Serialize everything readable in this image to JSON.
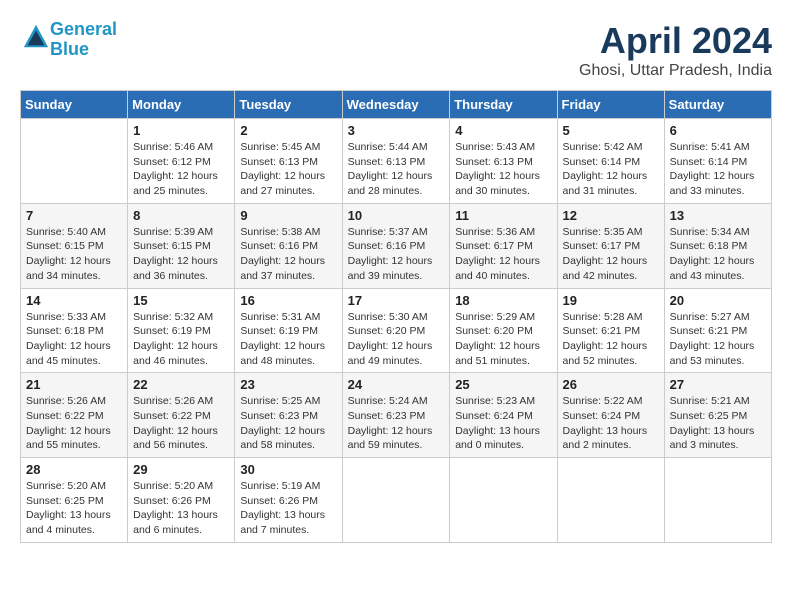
{
  "header": {
    "logo_line1": "General",
    "logo_line2": "Blue",
    "month": "April 2024",
    "location": "Ghosi, Uttar Pradesh, India"
  },
  "weekdays": [
    "Sunday",
    "Monday",
    "Tuesday",
    "Wednesday",
    "Thursday",
    "Friday",
    "Saturday"
  ],
  "weeks": [
    [
      {
        "day": "",
        "detail": ""
      },
      {
        "day": "1",
        "detail": "Sunrise: 5:46 AM\nSunset: 6:12 PM\nDaylight: 12 hours\nand 25 minutes."
      },
      {
        "day": "2",
        "detail": "Sunrise: 5:45 AM\nSunset: 6:13 PM\nDaylight: 12 hours\nand 27 minutes."
      },
      {
        "day": "3",
        "detail": "Sunrise: 5:44 AM\nSunset: 6:13 PM\nDaylight: 12 hours\nand 28 minutes."
      },
      {
        "day": "4",
        "detail": "Sunrise: 5:43 AM\nSunset: 6:13 PM\nDaylight: 12 hours\nand 30 minutes."
      },
      {
        "day": "5",
        "detail": "Sunrise: 5:42 AM\nSunset: 6:14 PM\nDaylight: 12 hours\nand 31 minutes."
      },
      {
        "day": "6",
        "detail": "Sunrise: 5:41 AM\nSunset: 6:14 PM\nDaylight: 12 hours\nand 33 minutes."
      }
    ],
    [
      {
        "day": "7",
        "detail": "Sunrise: 5:40 AM\nSunset: 6:15 PM\nDaylight: 12 hours\nand 34 minutes."
      },
      {
        "day": "8",
        "detail": "Sunrise: 5:39 AM\nSunset: 6:15 PM\nDaylight: 12 hours\nand 36 minutes."
      },
      {
        "day": "9",
        "detail": "Sunrise: 5:38 AM\nSunset: 6:16 PM\nDaylight: 12 hours\nand 37 minutes."
      },
      {
        "day": "10",
        "detail": "Sunrise: 5:37 AM\nSunset: 6:16 PM\nDaylight: 12 hours\nand 39 minutes."
      },
      {
        "day": "11",
        "detail": "Sunrise: 5:36 AM\nSunset: 6:17 PM\nDaylight: 12 hours\nand 40 minutes."
      },
      {
        "day": "12",
        "detail": "Sunrise: 5:35 AM\nSunset: 6:17 PM\nDaylight: 12 hours\nand 42 minutes."
      },
      {
        "day": "13",
        "detail": "Sunrise: 5:34 AM\nSunset: 6:18 PM\nDaylight: 12 hours\nand 43 minutes."
      }
    ],
    [
      {
        "day": "14",
        "detail": "Sunrise: 5:33 AM\nSunset: 6:18 PM\nDaylight: 12 hours\nand 45 minutes."
      },
      {
        "day": "15",
        "detail": "Sunrise: 5:32 AM\nSunset: 6:19 PM\nDaylight: 12 hours\nand 46 minutes."
      },
      {
        "day": "16",
        "detail": "Sunrise: 5:31 AM\nSunset: 6:19 PM\nDaylight: 12 hours\nand 48 minutes."
      },
      {
        "day": "17",
        "detail": "Sunrise: 5:30 AM\nSunset: 6:20 PM\nDaylight: 12 hours\nand 49 minutes."
      },
      {
        "day": "18",
        "detail": "Sunrise: 5:29 AM\nSunset: 6:20 PM\nDaylight: 12 hours\nand 51 minutes."
      },
      {
        "day": "19",
        "detail": "Sunrise: 5:28 AM\nSunset: 6:21 PM\nDaylight: 12 hours\nand 52 minutes."
      },
      {
        "day": "20",
        "detail": "Sunrise: 5:27 AM\nSunset: 6:21 PM\nDaylight: 12 hours\nand 53 minutes."
      }
    ],
    [
      {
        "day": "21",
        "detail": "Sunrise: 5:26 AM\nSunset: 6:22 PM\nDaylight: 12 hours\nand 55 minutes."
      },
      {
        "day": "22",
        "detail": "Sunrise: 5:26 AM\nSunset: 6:22 PM\nDaylight: 12 hours\nand 56 minutes."
      },
      {
        "day": "23",
        "detail": "Sunrise: 5:25 AM\nSunset: 6:23 PM\nDaylight: 12 hours\nand 58 minutes."
      },
      {
        "day": "24",
        "detail": "Sunrise: 5:24 AM\nSunset: 6:23 PM\nDaylight: 12 hours\nand 59 minutes."
      },
      {
        "day": "25",
        "detail": "Sunrise: 5:23 AM\nSunset: 6:24 PM\nDaylight: 13 hours\nand 0 minutes."
      },
      {
        "day": "26",
        "detail": "Sunrise: 5:22 AM\nSunset: 6:24 PM\nDaylight: 13 hours\nand 2 minutes."
      },
      {
        "day": "27",
        "detail": "Sunrise: 5:21 AM\nSunset: 6:25 PM\nDaylight: 13 hours\nand 3 minutes."
      }
    ],
    [
      {
        "day": "28",
        "detail": "Sunrise: 5:20 AM\nSunset: 6:25 PM\nDaylight: 13 hours\nand 4 minutes."
      },
      {
        "day": "29",
        "detail": "Sunrise: 5:20 AM\nSunset: 6:26 PM\nDaylight: 13 hours\nand 6 minutes."
      },
      {
        "day": "30",
        "detail": "Sunrise: 5:19 AM\nSunset: 6:26 PM\nDaylight: 13 hours\nand 7 minutes."
      },
      {
        "day": "",
        "detail": ""
      },
      {
        "day": "",
        "detail": ""
      },
      {
        "day": "",
        "detail": ""
      },
      {
        "day": "",
        "detail": ""
      }
    ]
  ]
}
